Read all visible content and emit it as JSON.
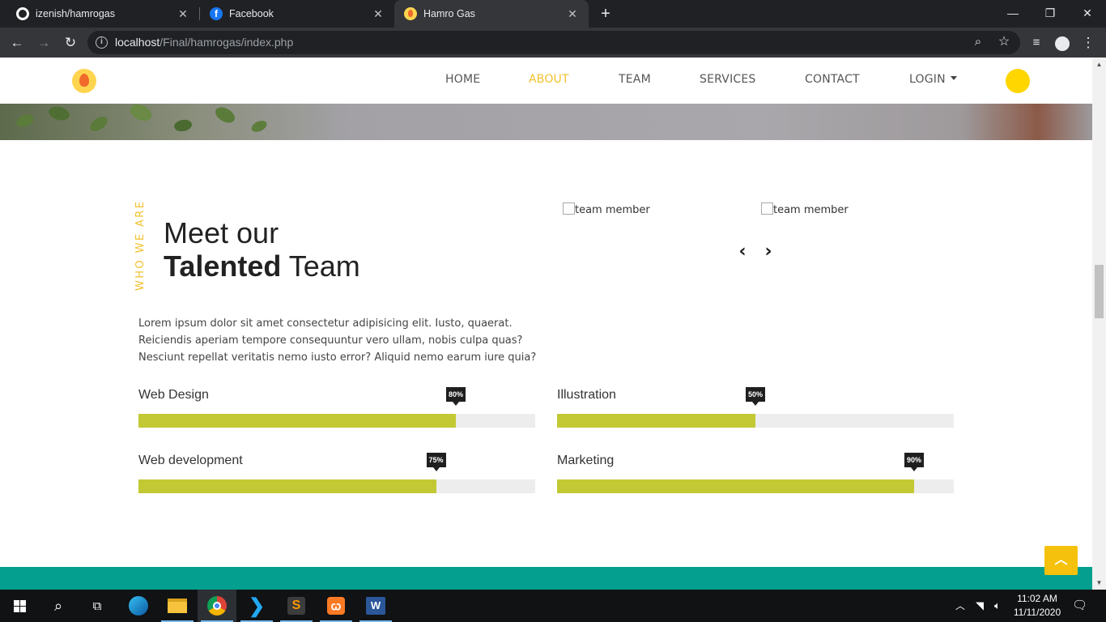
{
  "browser": {
    "tabs": [
      {
        "title": "izenish/hamrogas",
        "favicon": "github-icon"
      },
      {
        "title": "Facebook",
        "favicon": "facebook-icon"
      },
      {
        "title": "Hamro Gas",
        "favicon": "flame-icon"
      }
    ],
    "address": {
      "host": "localhost",
      "path": "/Final/hamrogas/index.php"
    }
  },
  "site": {
    "nav": {
      "items": [
        "HOME",
        "ABOUT",
        "TEAM",
        "SERVICES",
        "CONTACT",
        "LOGIN"
      ],
      "active": "ABOUT"
    },
    "about": {
      "vertical_label": "WHO WE ARE",
      "heading_line1": "Meet our",
      "heading_bold": "Talented",
      "heading_rest": " Team",
      "paragraph": "Lorem ipsum dolor sit amet consectetur adipisicing elit. Iusto, quaerat. Reiciendis aperiam tempore consequuntur vero ullam, nobis culpa quas? Nesciunt repellat veritatis nemo iusto error? Aliquid nemo earum iure quia?",
      "team_images": [
        {
          "alt": "team member"
        },
        {
          "alt": "team member"
        }
      ]
    },
    "skills": [
      {
        "label": "Web Design",
        "percent": 80,
        "percent_label": "80%"
      },
      {
        "label": "Illustration",
        "percent": 50,
        "percent_label": "50%"
      },
      {
        "label": "Web development",
        "percent": 75,
        "percent_label": "75%"
      },
      {
        "label": "Marketing",
        "percent": 90,
        "percent_label": "90%"
      }
    ],
    "colors": {
      "accent": "#f2c12e",
      "bar_fill": "#c2c934",
      "bar_bg": "#ededed",
      "teal": "#049f8e",
      "to_top": "#f5c10d"
    }
  },
  "taskbar": {
    "time": "11:02 AM",
    "date": "11/11/2020"
  }
}
